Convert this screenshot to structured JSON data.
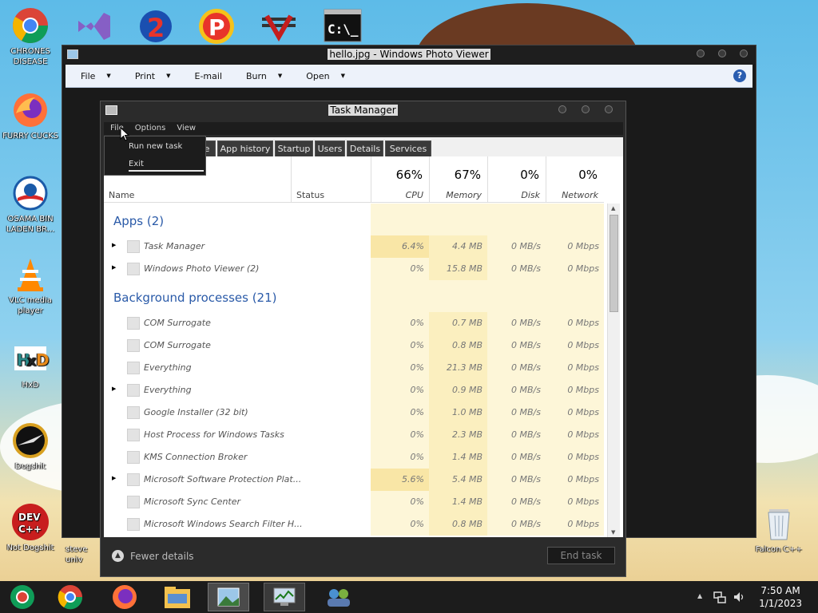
{
  "desktop": {
    "icons": [
      {
        "label": "CHRONES DISEASE"
      },
      {
        "label": "FURRY CUCKS"
      },
      {
        "label": "OSAMA BIN LADEN BR..."
      },
      {
        "label": "VLC media player"
      },
      {
        "label": "HxD"
      },
      {
        "label": "Dogshit"
      },
      {
        "label": "Not Dogshit"
      },
      {
        "label": "Falcon C++"
      }
    ],
    "partial_label": "steve univ"
  },
  "photo_viewer": {
    "title": "hello.jpg - Windows Photo Viewer",
    "menu": [
      {
        "label": "File"
      },
      {
        "label": "Print"
      },
      {
        "label": "E-mail"
      },
      {
        "label": "Burn"
      },
      {
        "label": "Open"
      }
    ],
    "help_glyph": "?"
  },
  "task_manager": {
    "title": "Task Manager",
    "menu": [
      "File",
      "Options",
      "View"
    ],
    "file_menu_items": [
      "Run new task",
      "Exit"
    ],
    "tabs": [
      "e",
      "App history",
      "Startup",
      "Users",
      "Details",
      "Services"
    ],
    "columns": {
      "name": "Name",
      "status": "Status",
      "cpu": {
        "pct": "66%",
        "label": "CPU"
      },
      "memory": {
        "pct": "67%",
        "label": "Memory"
      },
      "disk": {
        "pct": "0%",
        "label": "Disk"
      },
      "network": {
        "pct": "0%",
        "label": "Network"
      }
    },
    "groups": [
      {
        "title": "Apps (2)",
        "rows": [
          {
            "name": "Task Manager",
            "cpu": "6.4%",
            "mem": "4.4 MB",
            "disk": "0 MB/s",
            "net": "0 Mbps",
            "expand": true
          },
          {
            "name": "Windows Photo Viewer (2)",
            "cpu": "0%",
            "mem": "15.8 MB",
            "disk": "0 MB/s",
            "net": "0 Mbps",
            "expand": true
          }
        ]
      },
      {
        "title": "Background processes (21)",
        "rows": [
          {
            "name": "COM Surrogate",
            "cpu": "0%",
            "mem": "0.7 MB",
            "disk": "0 MB/s",
            "net": "0 Mbps",
            "expand": false
          },
          {
            "name": "COM Surrogate",
            "cpu": "0%",
            "mem": "0.8 MB",
            "disk": "0 MB/s",
            "net": "0 Mbps",
            "expand": false
          },
          {
            "name": "Everything",
            "cpu": "0%",
            "mem": "21.3 MB",
            "disk": "0 MB/s",
            "net": "0 Mbps",
            "expand": false
          },
          {
            "name": "Everything",
            "cpu": "0%",
            "mem": "0.9 MB",
            "disk": "0 MB/s",
            "net": "0 Mbps",
            "expand": true
          },
          {
            "name": "Google Installer (32 bit)",
            "cpu": "0%",
            "mem": "1.0 MB",
            "disk": "0 MB/s",
            "net": "0 Mbps",
            "expand": false
          },
          {
            "name": "Host Process for Windows Tasks",
            "cpu": "0%",
            "mem": "2.3 MB",
            "disk": "0 MB/s",
            "net": "0 Mbps",
            "expand": false
          },
          {
            "name": "KMS Connection Broker",
            "cpu": "0%",
            "mem": "1.4 MB",
            "disk": "0 MB/s",
            "net": "0 Mbps",
            "expand": false
          },
          {
            "name": "Microsoft Software Protection Plat...",
            "cpu": "5.6%",
            "mem": "5.4 MB",
            "disk": "0 MB/s",
            "net": "0 Mbps",
            "expand": true
          },
          {
            "name": "Microsoft Sync Center",
            "cpu": "0%",
            "mem": "1.4 MB",
            "disk": "0 MB/s",
            "net": "0 Mbps",
            "expand": false
          },
          {
            "name": "Microsoft Windows Search Filter H...",
            "cpu": "0%",
            "mem": "0.8 MB",
            "disk": "0 MB/s",
            "net": "0 Mbps",
            "expand": false
          }
        ]
      }
    ],
    "fewer_details": "Fewer details",
    "end_task": "End task"
  },
  "taskbar": {
    "time": "7:50 AM",
    "date": "1/1/2023"
  },
  "colors": {
    "heat_light": "#fdf6d8",
    "heat_medium": "#fbefbf",
    "heat_strong": "#f9e6a6",
    "group_title": "#2a5aa8"
  }
}
